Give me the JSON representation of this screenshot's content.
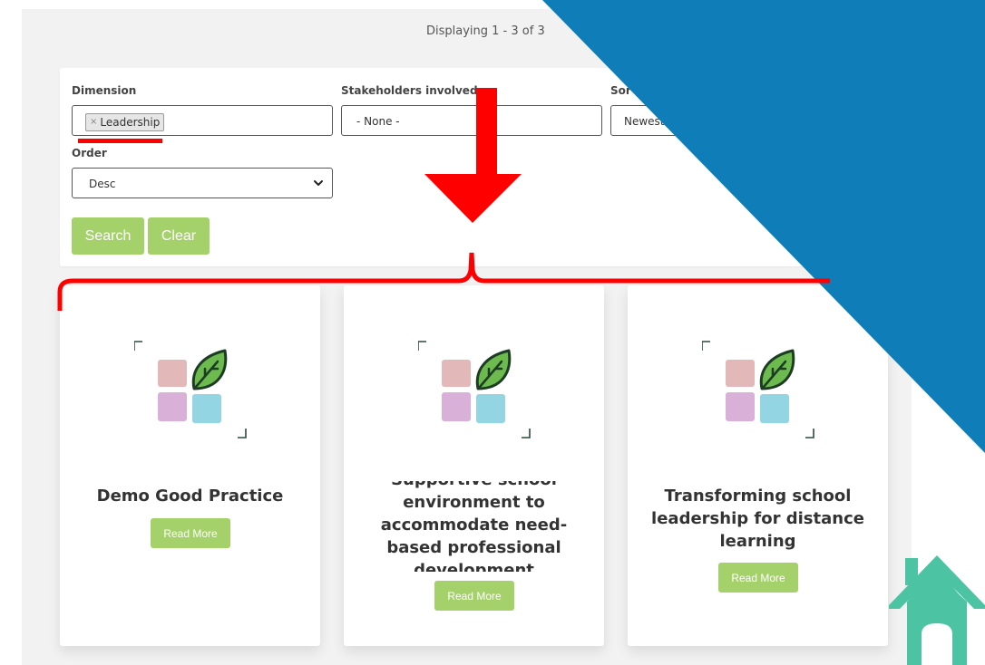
{
  "results": {
    "count_text": "Displaying 1 - 3 of 3"
  },
  "filters": {
    "dimension": {
      "label": "Dimension",
      "tag": "Leadership",
      "tag_remove": "×"
    },
    "stakeholders": {
      "label": "Stakeholders involved",
      "value": "- None -"
    },
    "sort": {
      "label": "Sor",
      "value": "Newest"
    },
    "order": {
      "label": "Order",
      "value": "Desc"
    },
    "search_label": "Search",
    "clear_label": "Clear"
  },
  "cards": [
    {
      "title_lines": [
        "Demo Good Practice"
      ],
      "button": "Read More"
    },
    {
      "title_lines": [
        "Supportive school",
        "environment to",
        "accommodate need-",
        "based professional",
        "development"
      ],
      "button": "Read More"
    },
    {
      "title_lines": [
        "Transforming school",
        "leadership for distance",
        "learning"
      ],
      "button": "Read More"
    }
  ],
  "colors": {
    "accent_green": "#a5d16a",
    "annotation_red": "#ff0000",
    "overlay_blue": "#0f7db8",
    "home_teal": "#4cc4a4"
  },
  "icons": {
    "dropdown": "chevron-down-icon",
    "home": "home-icon",
    "card_logo": "leaf-squares-logo"
  }
}
